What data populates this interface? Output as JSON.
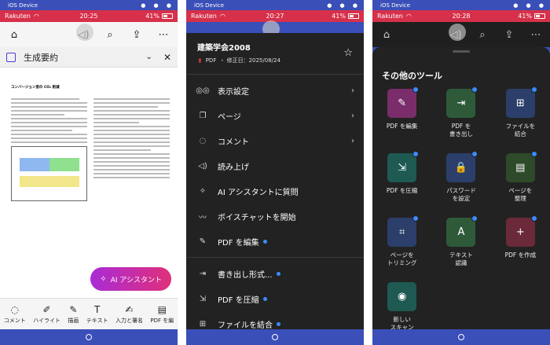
{
  "ios_bar": {
    "title": "iOS Device"
  },
  "status": {
    "carrier": "Rakuten",
    "battery": "41%"
  },
  "phones": [
    {
      "time": "20:25"
    },
    {
      "time": "20:27"
    },
    {
      "time": "20:28"
    }
  ],
  "p1": {
    "summary_title": "生成要約",
    "doc_title": "コンバージョン室の CO₂ 削減",
    "ai_button": "AI アシスタント",
    "tools": [
      "コメント",
      "ハイライト",
      "描画",
      "テキスト",
      "入力と署名",
      "PDF を編"
    ]
  },
  "p2": {
    "doc_name": "建築学会2008",
    "doc_type": "PDF",
    "doc_meta": "・ 修正日：2025/08/24",
    "items": [
      {
        "label": "表示設定",
        "arrow": true,
        "dot": false,
        "icon": "glasses-icon"
      },
      {
        "label": "ページ",
        "arrow": true,
        "dot": false,
        "icon": "pages-icon"
      },
      {
        "label": "コメント",
        "arrow": true,
        "dot": false,
        "icon": "comment-icon"
      },
      {
        "label": "読み上げ",
        "arrow": false,
        "dot": false,
        "icon": "speaker-icon"
      },
      {
        "label": "AI アシスタントに質問",
        "arrow": false,
        "dot": false,
        "icon": "ai-assistant-icon"
      },
      {
        "label": "ボイスチャットを開始",
        "arrow": false,
        "dot": false,
        "icon": "voice-icon"
      },
      {
        "label": "PDF を編集",
        "arrow": false,
        "dot": true,
        "icon": "edit-pdf-icon"
      },
      {
        "label": "書き出し形式...",
        "arrow": false,
        "dot": true,
        "icon": "export-icon"
      },
      {
        "label": "PDF を圧縮",
        "arrow": false,
        "dot": true,
        "icon": "compress-icon"
      },
      {
        "label": "ファイルを結合",
        "arrow": false,
        "dot": true,
        "icon": "combine-icon"
      }
    ]
  },
  "p3": {
    "title": "その他のツール",
    "tools": [
      {
        "label": "PDF を編集",
        "color": "#7a2d6a",
        "icon": "edit-pdf-icon",
        "glyph": "✎"
      },
      {
        "label": "PDF を\n書き出し",
        "color": "#2e5a3a",
        "icon": "export-pdf-icon",
        "glyph": "⇥"
      },
      {
        "label": "ファイルを\n結合",
        "color": "#2b3f6a",
        "icon": "combine-files-icon",
        "glyph": "⊞"
      },
      {
        "label": "PDF を圧縮",
        "color": "#1e5a52",
        "icon": "compress-pdf-icon",
        "glyph": "⇲"
      },
      {
        "label": "パスワード\nを設定",
        "color": "#2b3f6a",
        "icon": "password-icon",
        "glyph": "🔒"
      },
      {
        "label": "ページを\n整理",
        "color": "#2e4a2a",
        "icon": "organize-pages-icon",
        "glyph": "▤"
      },
      {
        "label": "ページを\nトリミング",
        "color": "#2b3f6a",
        "icon": "crop-pages-icon",
        "glyph": "⌗"
      },
      {
        "label": "テキスト\n認識",
        "color": "#2e5a3a",
        "icon": "ocr-icon",
        "glyph": "A"
      },
      {
        "label": "PDF を作成",
        "color": "#6a2a3a",
        "icon": "create-pdf-icon",
        "glyph": "+"
      },
      {
        "label": "新しい\nスキャン",
        "color": "#1e5a52",
        "icon": "scan-icon",
        "glyph": "◉"
      }
    ]
  }
}
